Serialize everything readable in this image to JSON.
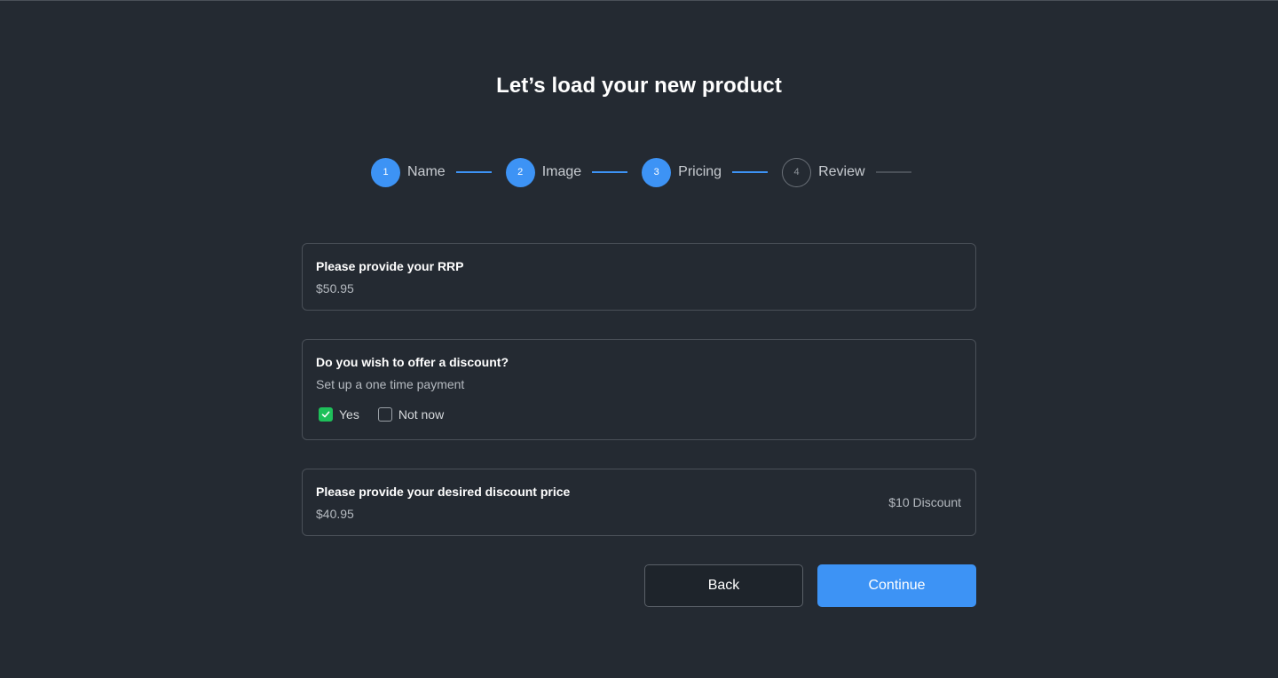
{
  "page": {
    "title": "Let’s load your new product"
  },
  "stepper": {
    "steps": [
      {
        "number": "1",
        "label": "Name",
        "state": "done"
      },
      {
        "number": "2",
        "label": "Image",
        "state": "done"
      },
      {
        "number": "3",
        "label": "Pricing",
        "state": "done"
      },
      {
        "number": "4",
        "label": "Review",
        "state": "pending"
      }
    ]
  },
  "rrp": {
    "label": "Please provide your RRP",
    "value": "$50.95"
  },
  "discount": {
    "label": "Do you wish to offer a discount?",
    "subtitle": "Set up a one time payment",
    "options": [
      {
        "label": "Yes",
        "checked": true
      },
      {
        "label": "Not now",
        "checked": false
      }
    ]
  },
  "discount_price": {
    "label": "Please provide your desired discount price",
    "value": "$40.95",
    "note": "$10 Discount"
  },
  "buttons": {
    "back": "Back",
    "continue": "Continue"
  },
  "colors": {
    "background": "#242a32",
    "accent": "#3d93f5",
    "check": "#1ec05a",
    "border": "#4a5058"
  }
}
